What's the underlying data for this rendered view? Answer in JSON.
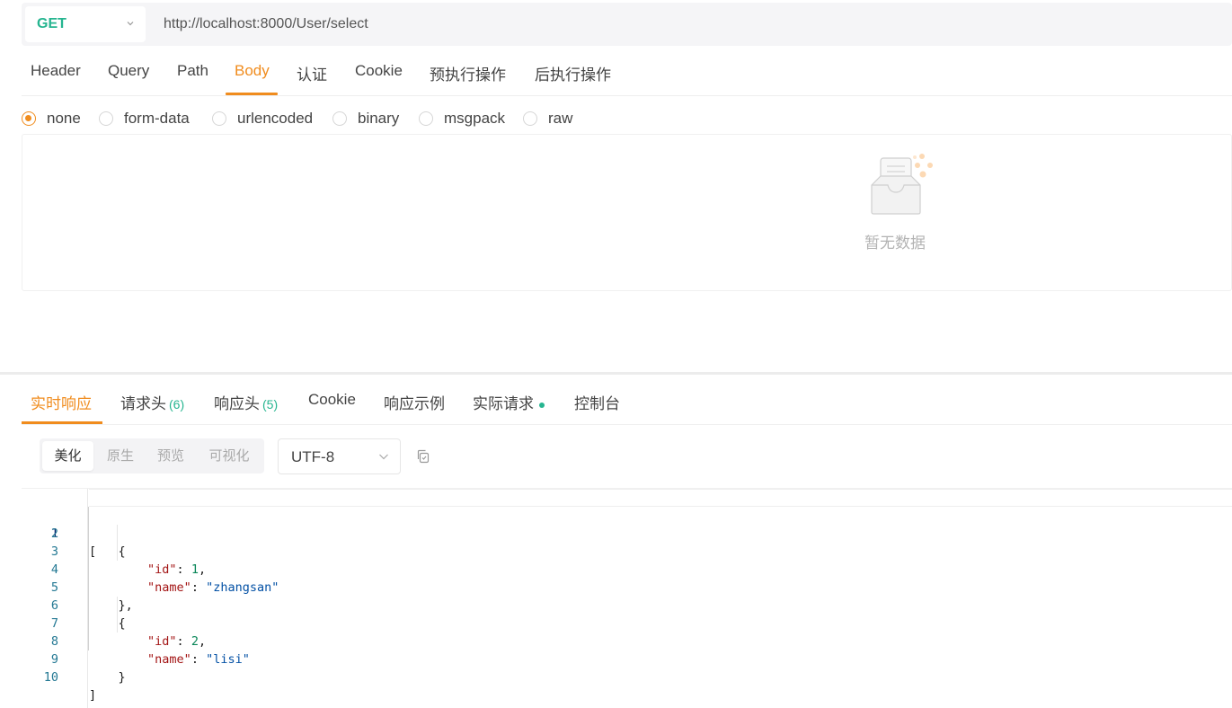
{
  "request": {
    "method": "GET",
    "url": "http://localhost:8000/User/select"
  },
  "request_tabs": [
    "Header",
    "Query",
    "Path",
    "Body",
    "认证",
    "Cookie",
    "预执行操作",
    "后执行操作"
  ],
  "active_request_tab": "Body",
  "body_types": [
    "none",
    "form-data",
    "urlencoded",
    "binary",
    "msgpack",
    "raw"
  ],
  "selected_body_type": "none",
  "body_empty_text": "暂无数据",
  "response_tabs": {
    "live": "实时响应",
    "req_headers": "请求头",
    "req_headers_count": "(6)",
    "resp_headers": "响应头",
    "resp_headers_count": "(5)",
    "cookie": "Cookie",
    "example": "响应示例",
    "actual": "实际请求",
    "console": "控制台"
  },
  "view_modes": [
    "美化",
    "原生",
    "预览",
    "可视化"
  ],
  "active_view_mode": "美化",
  "encoding": "UTF-8",
  "code_lines": [
    "1",
    "2",
    "3",
    "4",
    "5",
    "6",
    "7",
    "8",
    "9",
    "10"
  ],
  "response_json": [
    {
      "id": 1,
      "name": "zhangsan"
    },
    {
      "id": 2,
      "name": "lisi"
    }
  ],
  "colors": {
    "accent": "#f08c1e",
    "method_get": "#26b590",
    "count": "#26b590"
  }
}
